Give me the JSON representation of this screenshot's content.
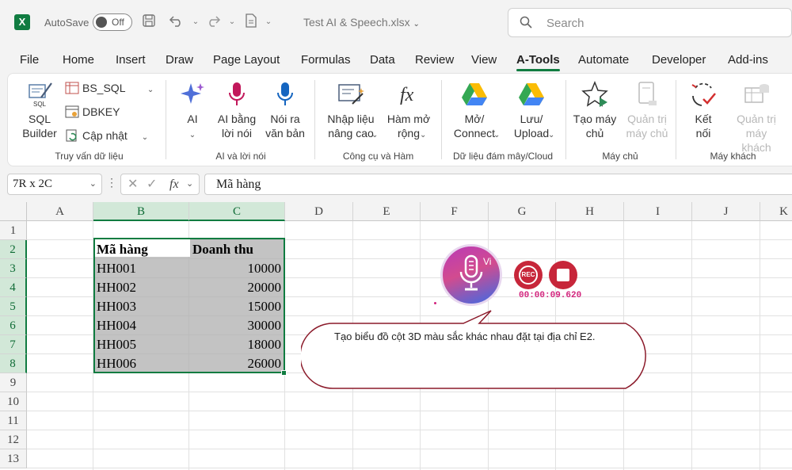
{
  "titlebar": {
    "logo_letter": "X",
    "autosave_label": "AutoSave",
    "autosave_state": "Off",
    "doc_title": "Test AI & Speech.xlsx",
    "search_placeholder": "Search"
  },
  "tabs": [
    "File",
    "Home",
    "Insert",
    "Draw",
    "Page Layout",
    "Formulas",
    "Data",
    "Review",
    "View",
    "A-Tools",
    "Automate",
    "Developer",
    "Add-ins"
  ],
  "active_tab": "A-Tools",
  "ribbon": {
    "sql_builder": "SQL Builder",
    "sql_icon_text": "SQL",
    "bs_sql": "BS_SQL",
    "dbkey": "DBKEY",
    "cap_nhat": "Cập nhật",
    "group_1": "Truy vấn dữ liệu",
    "ai": "AI",
    "ai_bang_loi_noi": "AI bằng lời nói",
    "noi_ra_van_ban": "Nói ra văn bản",
    "group_2": "AI và lời nói",
    "nhap_lieu_nang_cao": "Nhập liệu nâng cao",
    "ham_mo_rong": "Hàm mở rộng",
    "group_3": "Công cụ và Hàm",
    "mo_connect": "Mở/ Connect",
    "luu_upload": "Lưu/ Upload",
    "group_4": "Dữ liệu đám mây/Cloud",
    "tao_may_chu": "Tạo máy chủ",
    "quan_tri_may_chu": "Quản trị máy chủ",
    "group_5": "Máy chủ",
    "ket_noi": "Kết nối",
    "quan_tri_may_khach": "Quản trị máy khách",
    "group_6": "Máy khách"
  },
  "formula_bar": {
    "name_box": "7R x 2C",
    "fx_label": "fx",
    "content": "Mã hàng"
  },
  "grid": {
    "columns": [
      "A",
      "B",
      "C",
      "D",
      "E",
      "F",
      "G",
      "H",
      "I",
      "J",
      "K"
    ],
    "rows": [
      "1",
      "2",
      "3",
      "4",
      "5",
      "6",
      "7",
      "8",
      "9",
      "10",
      "11",
      "12",
      "13"
    ],
    "table_headers": [
      "Mã hàng",
      "Doanh thu"
    ],
    "table_rows": [
      [
        "HH001",
        "10000"
      ],
      [
        "HH002",
        "20000"
      ],
      [
        "HH003",
        "15000"
      ],
      [
        "HH004",
        "30000"
      ],
      [
        "HH005",
        "18000"
      ],
      [
        "HH006",
        "26000"
      ]
    ]
  },
  "voice": {
    "lang_badge": "Vi",
    "rec_label": "REC",
    "timer": "00:00:09.620",
    "transcript": "Tạo biểu đồ cột 3D màu sắc khác nhau đặt tại địa chỉ E2."
  },
  "colors": {
    "excel_green": "#107c41",
    "rec_red": "#c7263a",
    "bubble_border": "#8b1a2a",
    "timer_pink": "#d2237c"
  }
}
